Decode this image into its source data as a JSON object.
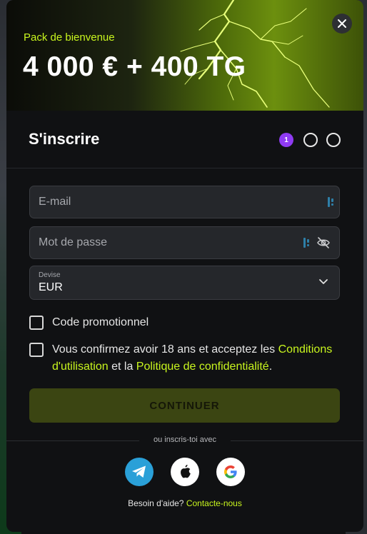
{
  "banner": {
    "subtitle": "Pack de bienvenue",
    "title": "4 000 € + 400 TG"
  },
  "header": {
    "title": "S'inscrire",
    "steps": {
      "current": "1"
    }
  },
  "form": {
    "email_placeholder": "E-mail",
    "password_placeholder": "Mot de passe",
    "currency_label": "Devise",
    "currency_value": "EUR"
  },
  "checks": {
    "promo_label": "Code promotionnel",
    "terms_prefix": "Vous confirmez avoir 18 ans et acceptez les ",
    "terms_link": "Conditions d'utilisation",
    "terms_mid": " et la ",
    "privacy_link": "Politique de confidentialité",
    "terms_suffix": "."
  },
  "actions": {
    "continue_label": "CONTINUER"
  },
  "social": {
    "divider": "ou inscris-toi avec",
    "icons": [
      "telegram-icon",
      "apple-icon",
      "google-icon"
    ]
  },
  "help": {
    "prefix": "Besoin d'aide? ",
    "link": "Contacte-nous"
  },
  "colors": {
    "accent": "#c8f51e",
    "step_active": "#8f3bf2",
    "continue_bg": "#3b4512",
    "telegram": "#2aa0d8"
  }
}
